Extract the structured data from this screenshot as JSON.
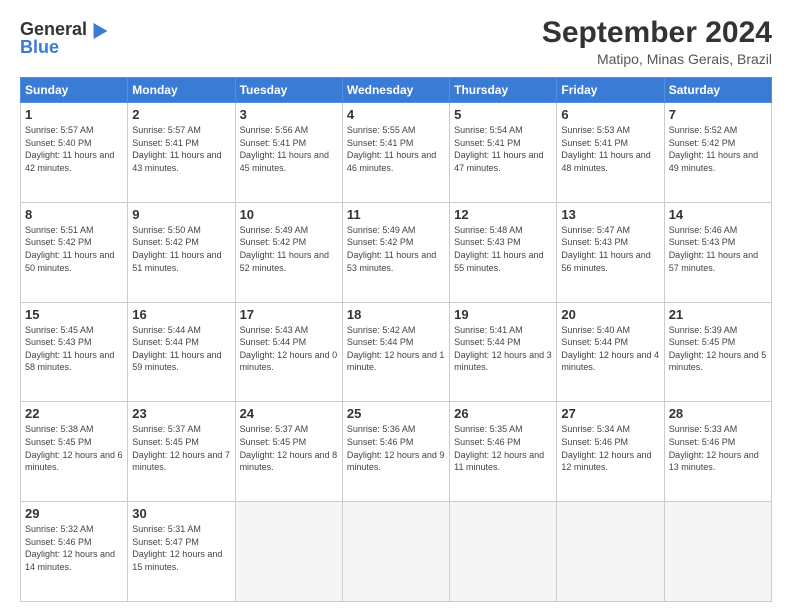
{
  "logo": {
    "general": "General",
    "blue": "Blue"
  },
  "title": "September 2024",
  "location": "Matipo, Minas Gerais, Brazil",
  "headers": [
    "Sunday",
    "Monday",
    "Tuesday",
    "Wednesday",
    "Thursday",
    "Friday",
    "Saturday"
  ],
  "days": [
    {
      "day": "",
      "sunrise": "",
      "sunset": "",
      "daylight": ""
    },
    {
      "day": "",
      "sunrise": "",
      "sunset": "",
      "daylight": ""
    },
    {
      "day": "",
      "sunrise": "",
      "sunset": "",
      "daylight": ""
    },
    {
      "day": "",
      "sunrise": "",
      "sunset": "",
      "daylight": ""
    },
    {
      "day": "",
      "sunrise": "",
      "sunset": "",
      "daylight": ""
    },
    {
      "day": "",
      "sunrise": "",
      "sunset": "",
      "daylight": ""
    },
    {
      "day": "1",
      "sunrise": "Sunrise: 5:57 AM",
      "sunset": "Sunset: 5:40 PM",
      "daylight": "Daylight: 11 hours and 42 minutes."
    },
    {
      "day": "2",
      "sunrise": "Sunrise: 5:57 AM",
      "sunset": "Sunset: 5:41 PM",
      "daylight": "Daylight: 11 hours and 43 minutes."
    },
    {
      "day": "3",
      "sunrise": "Sunrise: 5:56 AM",
      "sunset": "Sunset: 5:41 PM",
      "daylight": "Daylight: 11 hours and 45 minutes."
    },
    {
      "day": "4",
      "sunrise": "Sunrise: 5:55 AM",
      "sunset": "Sunset: 5:41 PM",
      "daylight": "Daylight: 11 hours and 46 minutes."
    },
    {
      "day": "5",
      "sunrise": "Sunrise: 5:54 AM",
      "sunset": "Sunset: 5:41 PM",
      "daylight": "Daylight: 11 hours and 47 minutes."
    },
    {
      "day": "6",
      "sunrise": "Sunrise: 5:53 AM",
      "sunset": "Sunset: 5:41 PM",
      "daylight": "Daylight: 11 hours and 48 minutes."
    },
    {
      "day": "7",
      "sunrise": "Sunrise: 5:52 AM",
      "sunset": "Sunset: 5:42 PM",
      "daylight": "Daylight: 11 hours and 49 minutes."
    },
    {
      "day": "8",
      "sunrise": "Sunrise: 5:51 AM",
      "sunset": "Sunset: 5:42 PM",
      "daylight": "Daylight: 11 hours and 50 minutes."
    },
    {
      "day": "9",
      "sunrise": "Sunrise: 5:50 AM",
      "sunset": "Sunset: 5:42 PM",
      "daylight": "Daylight: 11 hours and 51 minutes."
    },
    {
      "day": "10",
      "sunrise": "Sunrise: 5:49 AM",
      "sunset": "Sunset: 5:42 PM",
      "daylight": "Daylight: 11 hours and 52 minutes."
    },
    {
      "day": "11",
      "sunrise": "Sunrise: 5:49 AM",
      "sunset": "Sunset: 5:42 PM",
      "daylight": "Daylight: 11 hours and 53 minutes."
    },
    {
      "day": "12",
      "sunrise": "Sunrise: 5:48 AM",
      "sunset": "Sunset: 5:43 PM",
      "daylight": "Daylight: 11 hours and 55 minutes."
    },
    {
      "day": "13",
      "sunrise": "Sunrise: 5:47 AM",
      "sunset": "Sunset: 5:43 PM",
      "daylight": "Daylight: 11 hours and 56 minutes."
    },
    {
      "day": "14",
      "sunrise": "Sunrise: 5:46 AM",
      "sunset": "Sunset: 5:43 PM",
      "daylight": "Daylight: 11 hours and 57 minutes."
    },
    {
      "day": "15",
      "sunrise": "Sunrise: 5:45 AM",
      "sunset": "Sunset: 5:43 PM",
      "daylight": "Daylight: 11 hours and 58 minutes."
    },
    {
      "day": "16",
      "sunrise": "Sunrise: 5:44 AM",
      "sunset": "Sunset: 5:44 PM",
      "daylight": "Daylight: 11 hours and 59 minutes."
    },
    {
      "day": "17",
      "sunrise": "Sunrise: 5:43 AM",
      "sunset": "Sunset: 5:44 PM",
      "daylight": "Daylight: 12 hours and 0 minutes."
    },
    {
      "day": "18",
      "sunrise": "Sunrise: 5:42 AM",
      "sunset": "Sunset: 5:44 PM",
      "daylight": "Daylight: 12 hours and 1 minute."
    },
    {
      "day": "19",
      "sunrise": "Sunrise: 5:41 AM",
      "sunset": "Sunset: 5:44 PM",
      "daylight": "Daylight: 12 hours and 3 minutes."
    },
    {
      "day": "20",
      "sunrise": "Sunrise: 5:40 AM",
      "sunset": "Sunset: 5:44 PM",
      "daylight": "Daylight: 12 hours and 4 minutes."
    },
    {
      "day": "21",
      "sunrise": "Sunrise: 5:39 AM",
      "sunset": "Sunset: 5:45 PM",
      "daylight": "Daylight: 12 hours and 5 minutes."
    },
    {
      "day": "22",
      "sunrise": "Sunrise: 5:38 AM",
      "sunset": "Sunset: 5:45 PM",
      "daylight": "Daylight: 12 hours and 6 minutes."
    },
    {
      "day": "23",
      "sunrise": "Sunrise: 5:37 AM",
      "sunset": "Sunset: 5:45 PM",
      "daylight": "Daylight: 12 hours and 7 minutes."
    },
    {
      "day": "24",
      "sunrise": "Sunrise: 5:37 AM",
      "sunset": "Sunset: 5:45 PM",
      "daylight": "Daylight: 12 hours and 8 minutes."
    },
    {
      "day": "25",
      "sunrise": "Sunrise: 5:36 AM",
      "sunset": "Sunset: 5:46 PM",
      "daylight": "Daylight: 12 hours and 9 minutes."
    },
    {
      "day": "26",
      "sunrise": "Sunrise: 5:35 AM",
      "sunset": "Sunset: 5:46 PM",
      "daylight": "Daylight: 12 hours and 11 minutes."
    },
    {
      "day": "27",
      "sunrise": "Sunrise: 5:34 AM",
      "sunset": "Sunset: 5:46 PM",
      "daylight": "Daylight: 12 hours and 12 minutes."
    },
    {
      "day": "28",
      "sunrise": "Sunrise: 5:33 AM",
      "sunset": "Sunset: 5:46 PM",
      "daylight": "Daylight: 12 hours and 13 minutes."
    },
    {
      "day": "29",
      "sunrise": "Sunrise: 5:32 AM",
      "sunset": "Sunset: 5:46 PM",
      "daylight": "Daylight: 12 hours and 14 minutes."
    },
    {
      "day": "30",
      "sunrise": "Sunrise: 5:31 AM",
      "sunset": "Sunset: 5:47 PM",
      "daylight": "Daylight: 12 hours and 15 minutes."
    },
    {
      "day": "",
      "sunrise": "",
      "sunset": "",
      "daylight": ""
    },
    {
      "day": "",
      "sunrise": "",
      "sunset": "",
      "daylight": ""
    },
    {
      "day": "",
      "sunrise": "",
      "sunset": "",
      "daylight": ""
    },
    {
      "day": "",
      "sunrise": "",
      "sunset": "",
      "daylight": ""
    },
    {
      "day": "",
      "sunrise": "",
      "sunset": "",
      "daylight": ""
    }
  ]
}
